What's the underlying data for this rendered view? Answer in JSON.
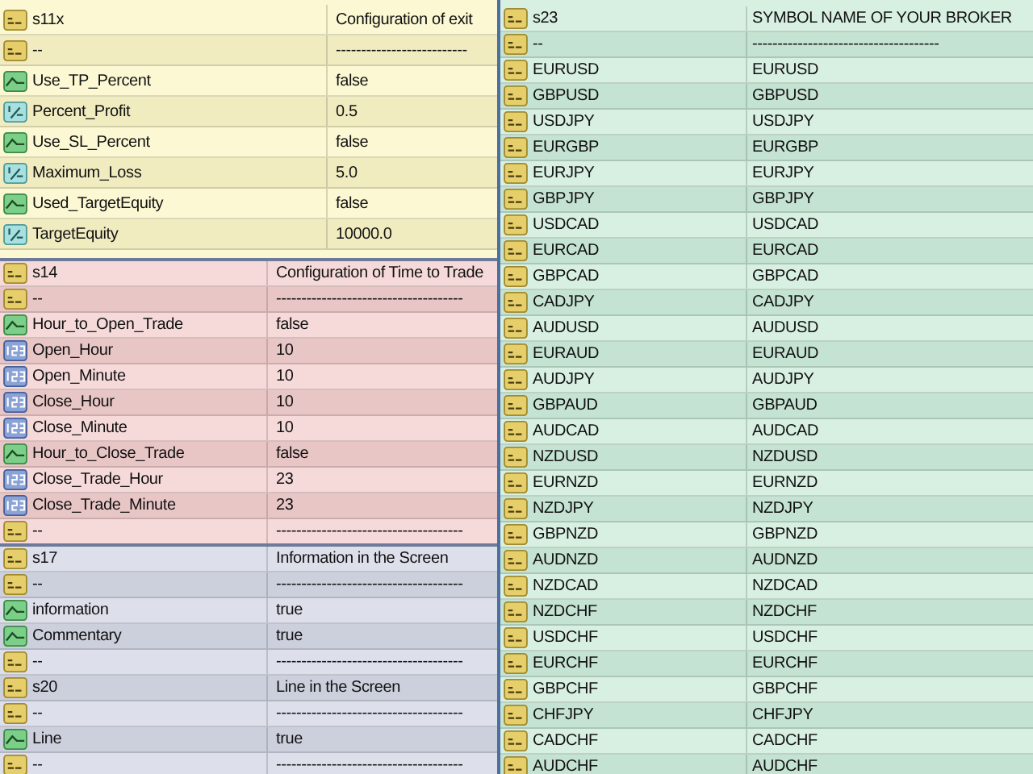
{
  "left_panels": [
    {
      "rows": [
        {
          "kind": "string",
          "name": "s11x",
          "value": "Configuration of exit"
        },
        {
          "kind": "string",
          "name": "--",
          "value": "--------------------------"
        },
        {
          "kind": "bool",
          "name": "Use_TP_Percent",
          "value": "false"
        },
        {
          "kind": "double",
          "name": "Percent_Profit",
          "value": "0.5"
        },
        {
          "kind": "bool",
          "name": "Use_SL_Percent",
          "value": "false"
        },
        {
          "kind": "double",
          "name": "Maximum_Loss",
          "value": "5.0"
        },
        {
          "kind": "bool",
          "name": "Used_TargetEquity",
          "value": "false"
        },
        {
          "kind": "double",
          "name": "TargetEquity",
          "value": "10000.0"
        }
      ]
    },
    {
      "rows": [
        {
          "kind": "string",
          "name": "s14",
          "value": "Configuration of Time to Trade"
        },
        {
          "kind": "string",
          "name": "--",
          "value": "-------------------------------------"
        },
        {
          "kind": "bool",
          "name": "Hour_to_Open_Trade",
          "value": "false"
        },
        {
          "kind": "int",
          "name": "Open_Hour",
          "value": "10"
        },
        {
          "kind": "int",
          "name": "Open_Minute",
          "value": "10"
        },
        {
          "kind": "int",
          "name": "Close_Hour",
          "value": "10"
        },
        {
          "kind": "int",
          "name": "Close_Minute",
          "value": "10"
        },
        {
          "kind": "bool",
          "name": "Hour_to_Close_Trade",
          "value": "false"
        },
        {
          "kind": "int",
          "name": "Close_Trade_Hour",
          "value": "23"
        },
        {
          "kind": "int",
          "name": "Close_Trade_Minute",
          "value": "23"
        },
        {
          "kind": "string",
          "name": "--",
          "value": "-------------------------------------"
        }
      ]
    },
    {
      "rows": [
        {
          "kind": "string",
          "name": "s17",
          "value": "Information in the Screen"
        },
        {
          "kind": "string",
          "name": "--",
          "value": "-------------------------------------"
        },
        {
          "kind": "bool",
          "name": "information",
          "value": "true"
        },
        {
          "kind": "bool",
          "name": "Commentary",
          "value": "true"
        },
        {
          "kind": "string",
          "name": "--",
          "value": "-------------------------------------"
        },
        {
          "kind": "string",
          "name": "s20",
          "value": "Line in the Screen"
        },
        {
          "kind": "string",
          "name": "--",
          "value": "-------------------------------------"
        },
        {
          "kind": "bool",
          "name": "Line",
          "value": "true"
        },
        {
          "kind": "string",
          "name": "--",
          "value": "-------------------------------------"
        }
      ]
    }
  ],
  "right_panel": {
    "rows": [
      {
        "kind": "string",
        "name": "s23",
        "value": "SYMBOL NAME OF YOUR BROKER"
      },
      {
        "kind": "string",
        "name": "--",
        "value": "-------------------------------------"
      },
      {
        "kind": "string",
        "name": "EURUSD",
        "value": "EURUSD"
      },
      {
        "kind": "string",
        "name": "GBPUSD",
        "value": "GBPUSD"
      },
      {
        "kind": "string",
        "name": "USDJPY",
        "value": "USDJPY"
      },
      {
        "kind": "string",
        "name": "EURGBP",
        "value": "EURGBP"
      },
      {
        "kind": "string",
        "name": "EURJPY",
        "value": "EURJPY"
      },
      {
        "kind": "string",
        "name": "GBPJPY",
        "value": "GBPJPY"
      },
      {
        "kind": "string",
        "name": "USDCAD",
        "value": "USDCAD"
      },
      {
        "kind": "string",
        "name": "EURCAD",
        "value": "EURCAD"
      },
      {
        "kind": "string",
        "name": "GBPCAD",
        "value": "GBPCAD"
      },
      {
        "kind": "string",
        "name": "CADJPY",
        "value": "CADJPY"
      },
      {
        "kind": "string",
        "name": "AUDUSD",
        "value": "AUDUSD"
      },
      {
        "kind": "string",
        "name": "EURAUD",
        "value": "EURAUD"
      },
      {
        "kind": "string",
        "name": "AUDJPY",
        "value": "AUDJPY"
      },
      {
        "kind": "string",
        "name": "GBPAUD",
        "value": "GBPAUD"
      },
      {
        "kind": "string",
        "name": "AUDCAD",
        "value": "AUDCAD"
      },
      {
        "kind": "string",
        "name": "NZDUSD",
        "value": "NZDUSD"
      },
      {
        "kind": "string",
        "name": "EURNZD",
        "value": "EURNZD"
      },
      {
        "kind": "string",
        "name": "NZDJPY",
        "value": "NZDJPY"
      },
      {
        "kind": "string",
        "name": "GBPNZD",
        "value": "GBPNZD"
      },
      {
        "kind": "string",
        "name": "AUDNZD",
        "value": "AUDNZD"
      },
      {
        "kind": "string",
        "name": "NZDCAD",
        "value": "NZDCAD"
      },
      {
        "kind": "string",
        "name": "NZDCHF",
        "value": "NZDCHF"
      },
      {
        "kind": "string",
        "name": "USDCHF",
        "value": "USDCHF"
      },
      {
        "kind": "string",
        "name": "EURCHF",
        "value": "EURCHF"
      },
      {
        "kind": "string",
        "name": "GBPCHF",
        "value": "GBPCHF"
      },
      {
        "kind": "string",
        "name": "CHFJPY",
        "value": "CHFJPY"
      },
      {
        "kind": "string",
        "name": "CADCHF",
        "value": "CADCHF"
      },
      {
        "kind": "string",
        "name": "AUDCHF",
        "value": "AUDCHF"
      }
    ]
  }
}
